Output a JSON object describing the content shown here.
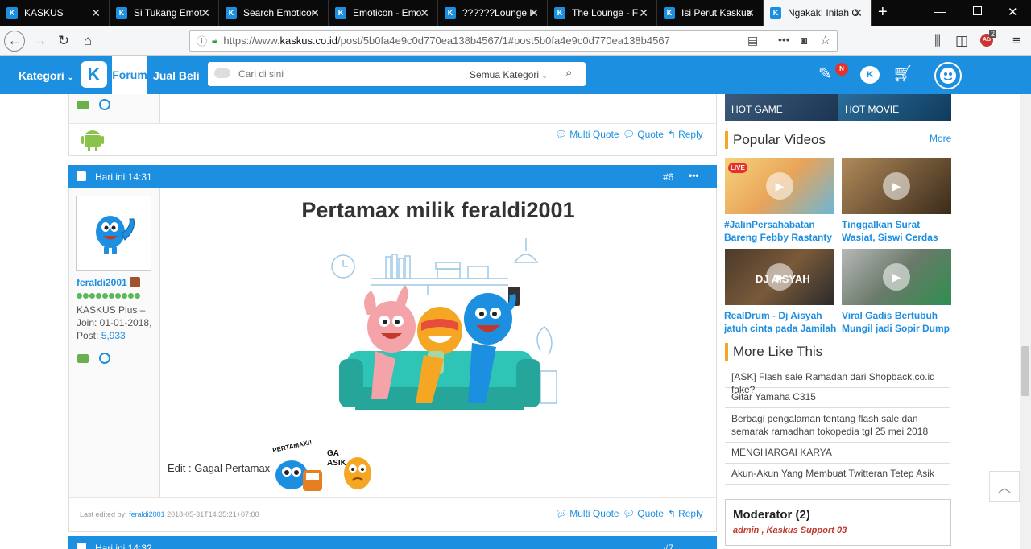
{
  "browser": {
    "tabs": [
      {
        "label": "KASKUS"
      },
      {
        "label": "Si Tukang Emot"
      },
      {
        "label": "Search Emoticon"
      },
      {
        "label": "Emoticon - Emo"
      },
      {
        "label": "??????Lounge K"
      },
      {
        "label": "The Lounge - F"
      },
      {
        "label": "Isi Perut Kaskus"
      },
      {
        "label": "Ngakak! Inilah C"
      }
    ],
    "url_prefix": "https://www.",
    "url_domain": "kaskus.co.id",
    "url_path": "/post/5b0fa4e9c0d770ea138b4567/1#post5b0fa4e9c0d770ea138b4567",
    "addon_badge": "2"
  },
  "header": {
    "kategori": "Kategori",
    "forum": "Forum",
    "jualbeli": "Jual Beli",
    "search_placeholder": "Cari di sini",
    "search_category": "Semua Kategori",
    "notif_badge": "N"
  },
  "prev_post": {
    "actions": {
      "multi_quote": "Multi Quote",
      "quote": "Quote",
      "reply": "Reply"
    }
  },
  "post": {
    "time": "Hari ini 14:31",
    "number": "#6",
    "more": "•••",
    "username": "feraldi2001",
    "rank": "KASKUS Plus –",
    "join": "Join: 01-01-2018,",
    "post_label": "Post:",
    "post_count": "5,933",
    "title": "Pertamax milik feraldi2001",
    "edit_text": "Edit : Gagal Pertamax",
    "sticker1_text": "PERTAMAX!!",
    "sticker2_text": "GA\nASIK",
    "last_edited_label": "Last edited by:",
    "last_edited_user": "feraldi2001",
    "last_edited_time": "2018-05-31T14:35:21+07:00",
    "actions": {
      "multi_quote": "Multi Quote",
      "quote": "Quote",
      "reply": "Reply"
    }
  },
  "next_post": {
    "time": "Hari ini 14:32",
    "number": "#7"
  },
  "sidebar": {
    "hot_game": "HOT GAME",
    "hot_movie": "HOT MOVIE",
    "popular_videos_title": "Popular Videos",
    "more": "More",
    "videos": [
      {
        "title": "#JalinPersahabatan Bareng Febby Rastanty di",
        "thumb_text": "LIVE"
      },
      {
        "title": "Tinggalkan Surat Wasiat, Siswi Cerdas Gantung Diri",
        "thumb_text": ""
      },
      {
        "title": "RealDrum - Dj Aisyah jatuh cinta pada Jamilah",
        "thumb_text": "DJ AISYAH"
      },
      {
        "title": "Viral Gadis Bertubuh Mungil jadi Sopir Dump",
        "thumb_text": ""
      }
    ],
    "more_like_title": "More Like This",
    "more_like": [
      "[ASK] Flash sale Ramadan dari Shopback.co.id fake?",
      "Gitar Yamaha C315",
      "Berbagi pengalaman tentang flash sale dan semarak ramadhan tokopedia tgl 25 mei 2018",
      "MENGHARGAI KARYA",
      "Akun-Akun Yang Membuat Twitteran Tetep Asik"
    ],
    "moderator_title": "Moderator (2)",
    "moderators": "admin , Kaskus Support 03"
  },
  "colors": {
    "brand_blue": "#1d8fe1",
    "accent_orange": "#f5a623",
    "online_green": "#5cb85c"
  }
}
